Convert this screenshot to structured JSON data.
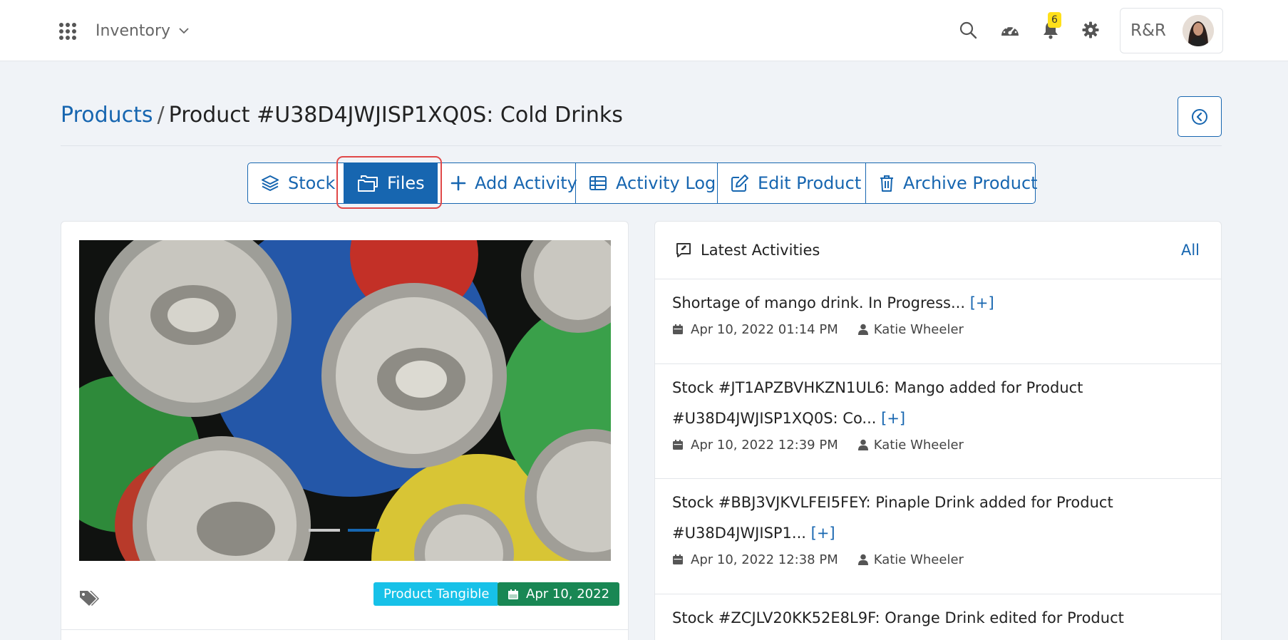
{
  "topbar": {
    "app_name": "Inventory",
    "notification_count": "6",
    "user_initials": "R&R"
  },
  "header": {
    "breadcrumb_root": "Products",
    "breadcrumb_separator": "/",
    "page_title": "Product #U38D4JWJISP1XQ0S: Cold Drinks"
  },
  "toolbar": {
    "stock": "Stock",
    "files": "Files",
    "add_activity": "Add Activity",
    "activity_log": "Activity Log",
    "edit_product": "Edit Product",
    "archive_product": "Archive Product"
  },
  "product": {
    "type_badge": "Product Tangible",
    "date_badge": "Apr 10, 2022"
  },
  "activities": {
    "title": "Latest Activities",
    "all_link": "All",
    "expand_label": "[+]",
    "items": [
      {
        "text": "Shortage of mango drink. In Progress...",
        "date": "Apr 10, 2022 01:14 PM",
        "user": "Katie Wheeler"
      },
      {
        "text": "Stock #JT1APZBVHKZN1UL6: Mango added for Product #U38D4JWJISP1XQ0S: Co...",
        "date": "Apr 10, 2022 12:39 PM",
        "user": "Katie Wheeler"
      },
      {
        "text": "Stock #BBJ3VJKVLFEI5FEY: Pinaple Drink added for Product #U38D4JWJISP1...",
        "date": "Apr 10, 2022 12:38 PM",
        "user": "Katie Wheeler"
      },
      {
        "text": "Stock #ZCJLV20KK52E8L9F: Orange Drink edited for Product",
        "date": "",
        "user": ""
      }
    ]
  },
  "colors": {
    "primary": "#1766b0",
    "info": "#17c1e8",
    "success": "#198754",
    "badge": "#ffe01b",
    "highlight": "#e04848"
  },
  "icons": {
    "apps": "grid-icon",
    "search": "search-icon",
    "dashboard": "speedometer-icon",
    "notifications": "bell-icon",
    "settings": "gear-icon"
  }
}
